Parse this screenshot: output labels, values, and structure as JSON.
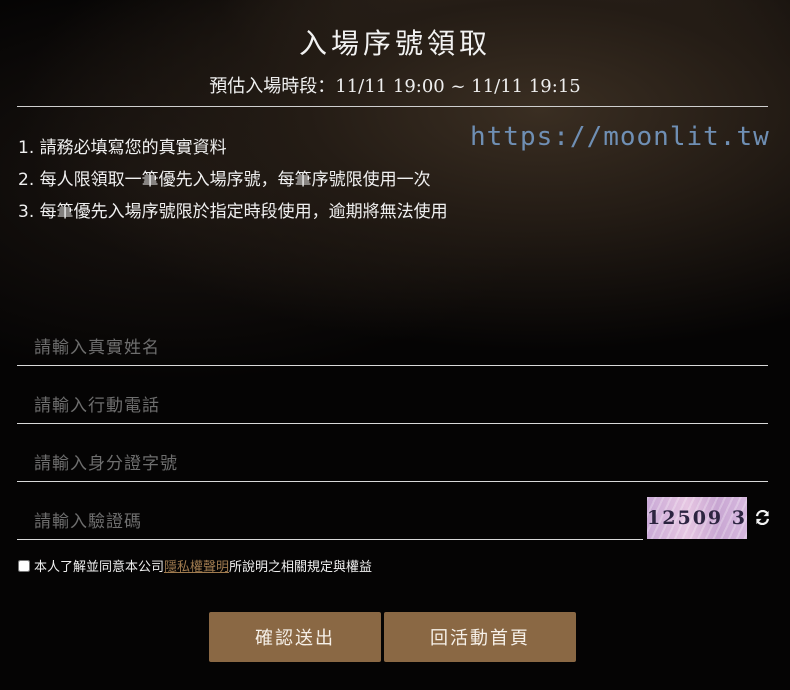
{
  "header": {
    "title": "入場序號領取",
    "time_label": "預估入場時段：",
    "time_range": "11/11 19:00 ~ 11/11 19:15"
  },
  "notes": [
    "1. 請務必填寫您的真實資料",
    "2. 每人限領取一筆優先入場序號，每筆序號限使用一次",
    "3. 每筆優先入場序號限於指定時段使用，逾期將無法使用"
  ],
  "watermark": "https://moonlit.tw",
  "form": {
    "name_placeholder": "請輸入真實姓名",
    "phone_placeholder": "請輸入行動電話",
    "id_placeholder": "請輸入身分證字號",
    "captcha_placeholder": "請輸入驗證碼",
    "captcha_text": "12509 3",
    "refresh_icon": "refresh-icon"
  },
  "agreement": {
    "prefix": "本人了解並同意本公司",
    "link": "隱私權聲明",
    "suffix": "所說明之相關規定與權益"
  },
  "buttons": {
    "submit": "確認送出",
    "home": "回活動首頁"
  },
  "colors": {
    "button_bg": "#8a6844",
    "link": "#a07b4f",
    "watermark": "#6f8fb4"
  }
}
